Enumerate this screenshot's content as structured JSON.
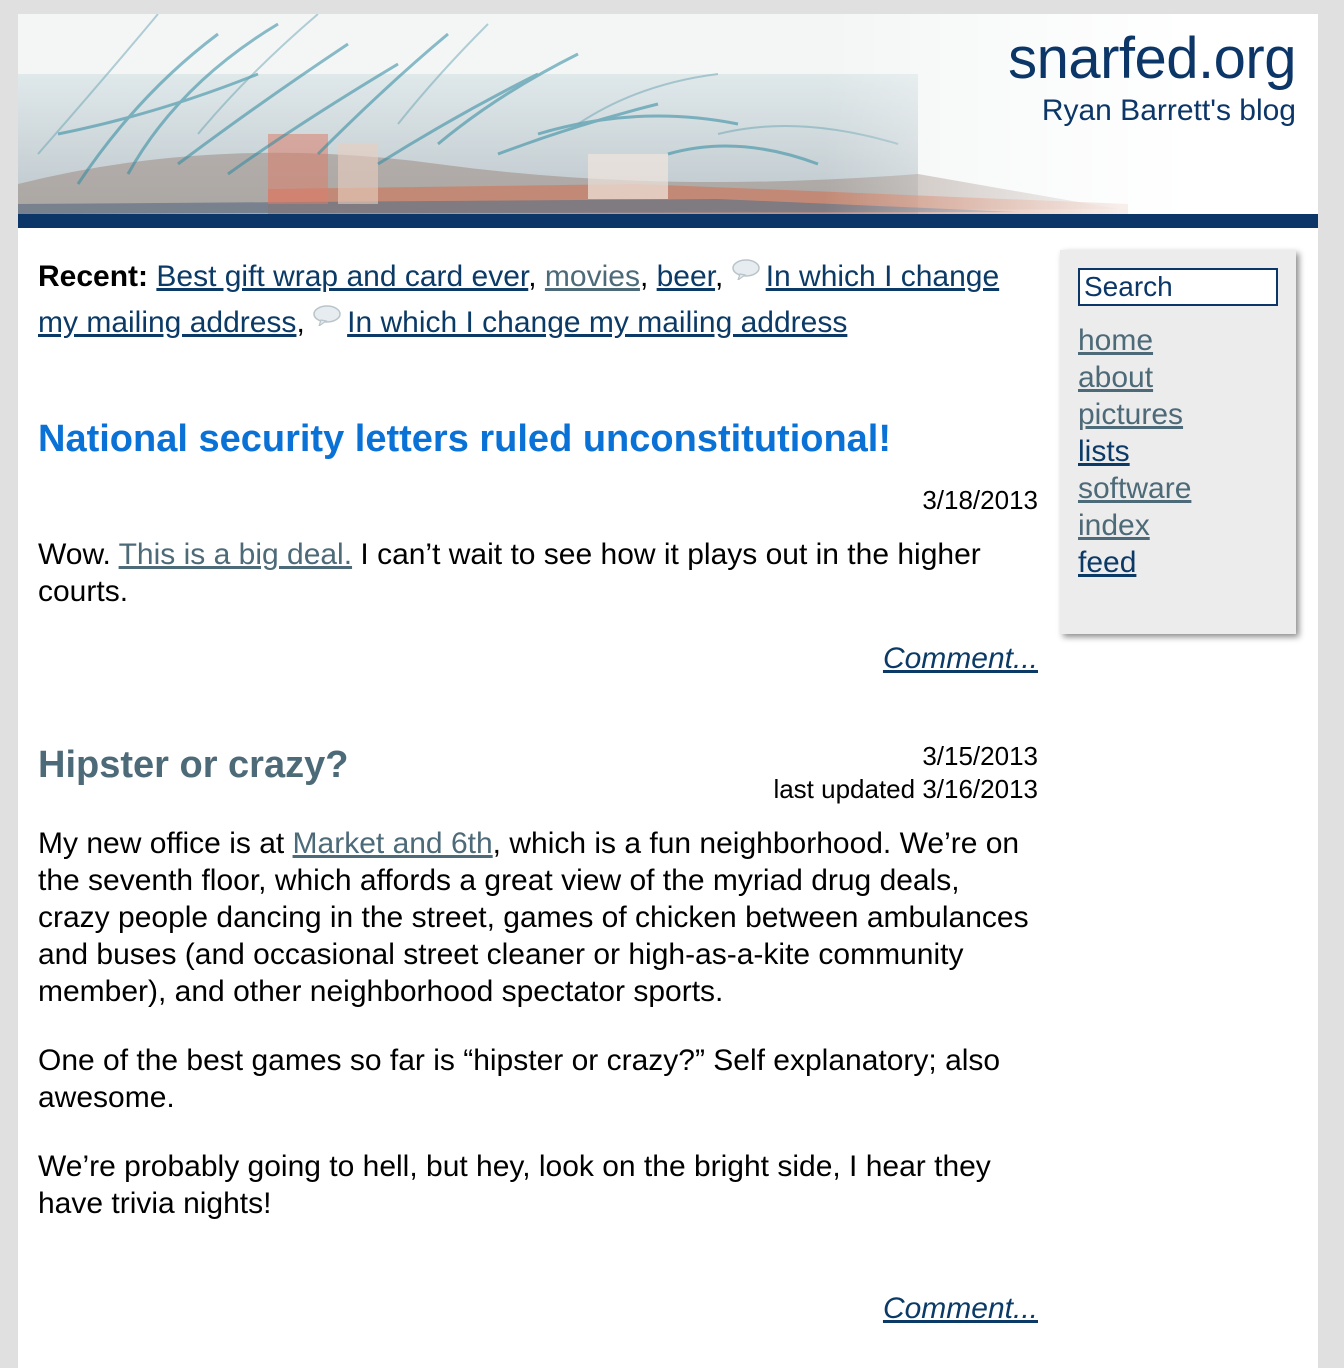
{
  "header": {
    "title": "snarfed.org",
    "subtitle": "Ryan Barrett's blog"
  },
  "recent": {
    "label": "Recent:",
    "links": [
      {
        "text": "Best gift wrap and card ever",
        "visited": false,
        "icon": null
      },
      {
        "text": "movies",
        "visited": true,
        "icon": null
      },
      {
        "text": "beer",
        "visited": false,
        "icon": null
      },
      {
        "text": "In which I change my mailing address",
        "visited": false,
        "icon": "comment-bubble-icon"
      },
      {
        "text": "In which I change my mailing address",
        "visited": false,
        "icon": "comment-bubble-icon"
      }
    ]
  },
  "posts": [
    {
      "title": "National security letters ruled unconstitutional!",
      "date": "3/18/2013",
      "body_before": "Wow. ",
      "body_link": "This is a big deal.",
      "body_after": " I can’t wait to see how it plays out in the higher courts.",
      "comment_label": "Comment..."
    },
    {
      "title": "Hipster or crazy?",
      "date": "3/15/2013",
      "updated": "last updated 3/16/2013",
      "p1_before": "My new office is at ",
      "p1_link": "Market and 6th",
      "p1_after": ", which is a fun neighborhood. We’re on the seventh floor, which affords a great view of the myriad drug deals, crazy people dancing in the street, games of chicken between ambulances and buses (and occasional street cleaner or high-as-a-kite community member), and other neighborhood spectator sports.",
      "p2": "One of the best games so far is “hipster or crazy?” Self explanatory; also awesome.",
      "p3": "We’re probably going to hell, but hey, look on the bright side, I hear they have trivia nights!",
      "comment_label": "Comment..."
    }
  ],
  "sidebar": {
    "search_placeholder": "Search",
    "nav": [
      {
        "label": "home",
        "visited": true
      },
      {
        "label": "about",
        "visited": true
      },
      {
        "label": "pictures",
        "visited": true
      },
      {
        "label": "lists",
        "visited": false
      },
      {
        "label": "software",
        "visited": true
      },
      {
        "label": "index",
        "visited": true
      },
      {
        "label": "feed",
        "visited": false
      }
    ]
  },
  "colors": {
    "brand_navy": "#0b3667",
    "title_blue": "#0a72d6",
    "visited_link": "#4d6a78",
    "sidebar_bg": "#ececec",
    "page_bg": "#e0e0e0"
  }
}
